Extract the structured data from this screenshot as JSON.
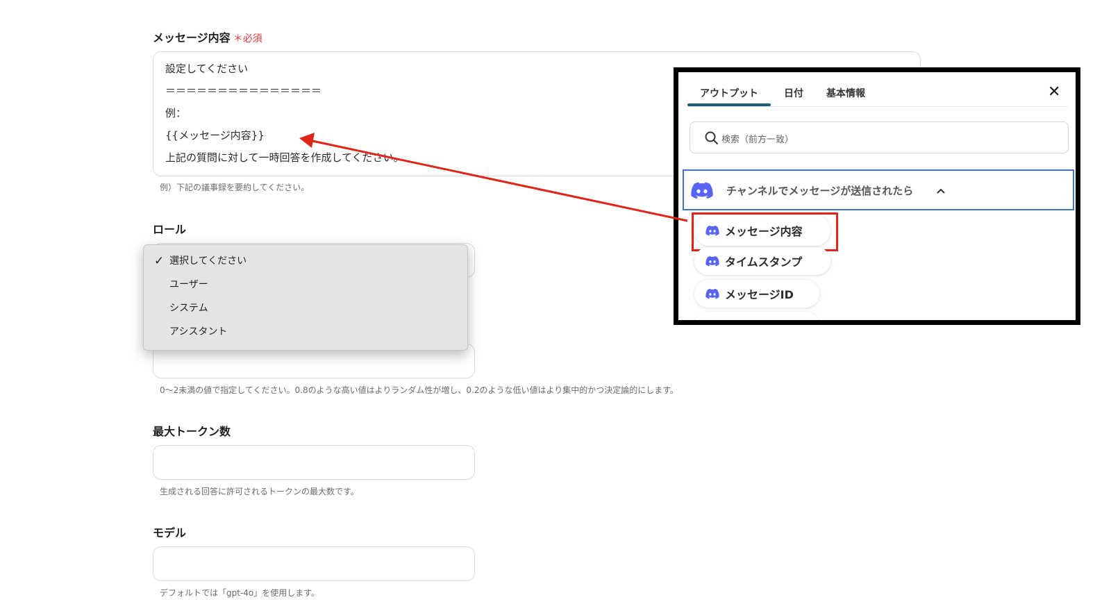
{
  "message_field": {
    "label": "メッセージ内容",
    "required_mark": "＊",
    "required_text": "必須",
    "lines": [
      "設定してください",
      "＝＝＝＝＝＝＝＝＝＝＝＝＝＝＝",
      "例：",
      "{{メッセージ内容}}",
      "上記の質問に対して一時回答を作成してください。"
    ],
    "hint": "例）下記の議事録を要約してください。"
  },
  "role_field": {
    "label": "ロール",
    "options": [
      "選択してください",
      "ユーザー",
      "システム",
      "アシスタント"
    ],
    "selected_index": 0,
    "check_glyph": "✓"
  },
  "temperature_field": {
    "value": "",
    "hint": "0〜2未満の値で指定してください。0.8のような高い値はよりランダム性が増し、0.2のような低い値はより集中的かつ決定論的にします。"
  },
  "max_tokens_field": {
    "label": "最大トークン数",
    "value": "",
    "hint": "生成される回答に許可されるトークンの最大数です。"
  },
  "model_field": {
    "label": "モデル",
    "value": "",
    "hint": "デフォルトでは「gpt-4o」を使用します。"
  },
  "output_panel": {
    "tabs": [
      "アウトプット",
      "日付",
      "基本情報"
    ],
    "active_tab_index": 0,
    "close_glyph": "✕",
    "search_placeholder": "検索（前方一致）",
    "group_title": "チャンネルでメッセージが送信されたら",
    "group_expanded": true,
    "items": [
      "メッセージ内容",
      "タイムスタンプ",
      "メッセージID"
    ],
    "highlighted_item_index": 0
  },
  "colors": {
    "discord": "#5865f2",
    "annotation_red": "#e02418",
    "required_red": "#e5383b",
    "tab_underline": "#1a5f74",
    "group_border": "#3f72c8"
  },
  "icons": [
    "discord-icon",
    "search-icon",
    "close-icon",
    "chevron-up-icon",
    "checkmark-icon"
  ]
}
